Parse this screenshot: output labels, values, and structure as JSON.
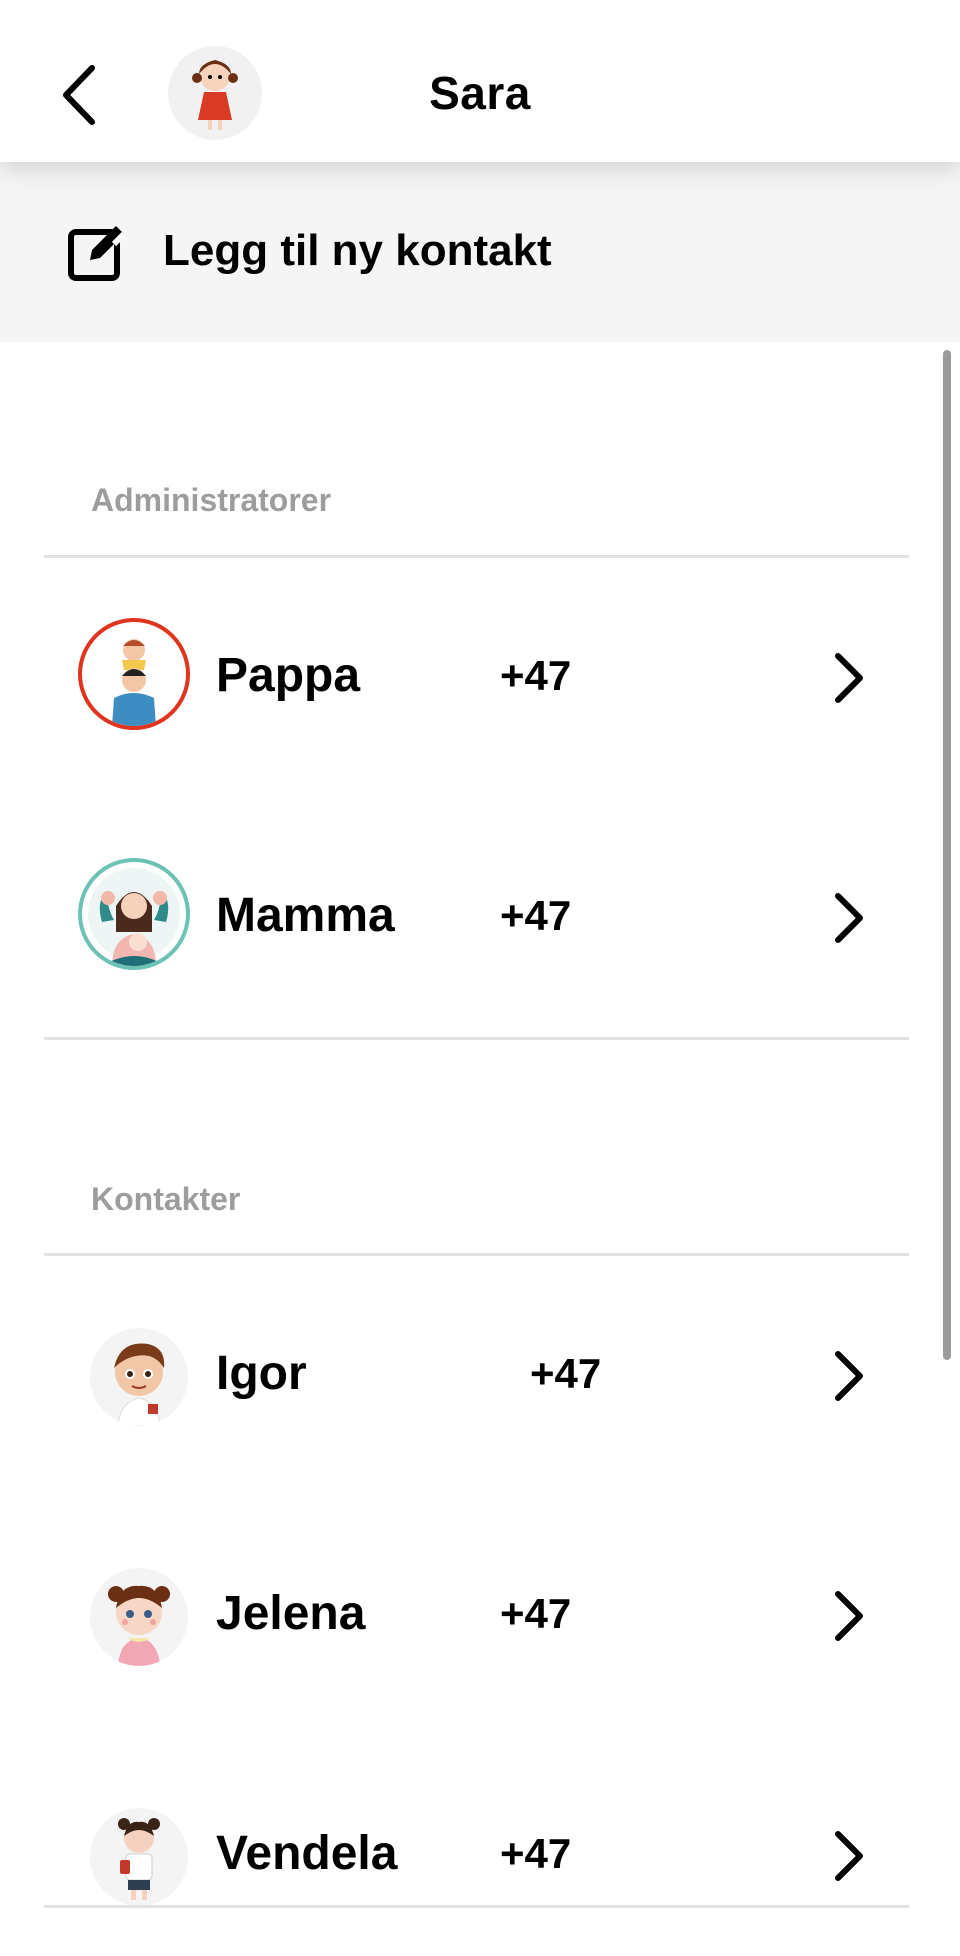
{
  "header": {
    "title": "Sara",
    "back_icon": "chevron-left-icon",
    "avatar_icon": "girl-avatar"
  },
  "add_contact": {
    "label": "Legg til ny kontakt",
    "icon": "edit-square-icon"
  },
  "sections": {
    "admins": {
      "title": "Administratorer",
      "rows": [
        {
          "name": "Pappa",
          "phone": "+47",
          "ring_color": "#e0341e"
        },
        {
          "name": "Mamma",
          "phone": "+47",
          "ring_color": "#6cc3b5"
        }
      ]
    },
    "contacts": {
      "title": "Kontakter",
      "rows": [
        {
          "name": "Igor",
          "phone": "+47"
        },
        {
          "name": "Jelena",
          "phone": "+47"
        },
        {
          "name": "Vendela",
          "phone": "+47"
        }
      ]
    }
  },
  "colors": {
    "section_title": "#9d9d9d",
    "add_bar_bg": "#f5f5f5",
    "divider": "#e2e2e2"
  }
}
